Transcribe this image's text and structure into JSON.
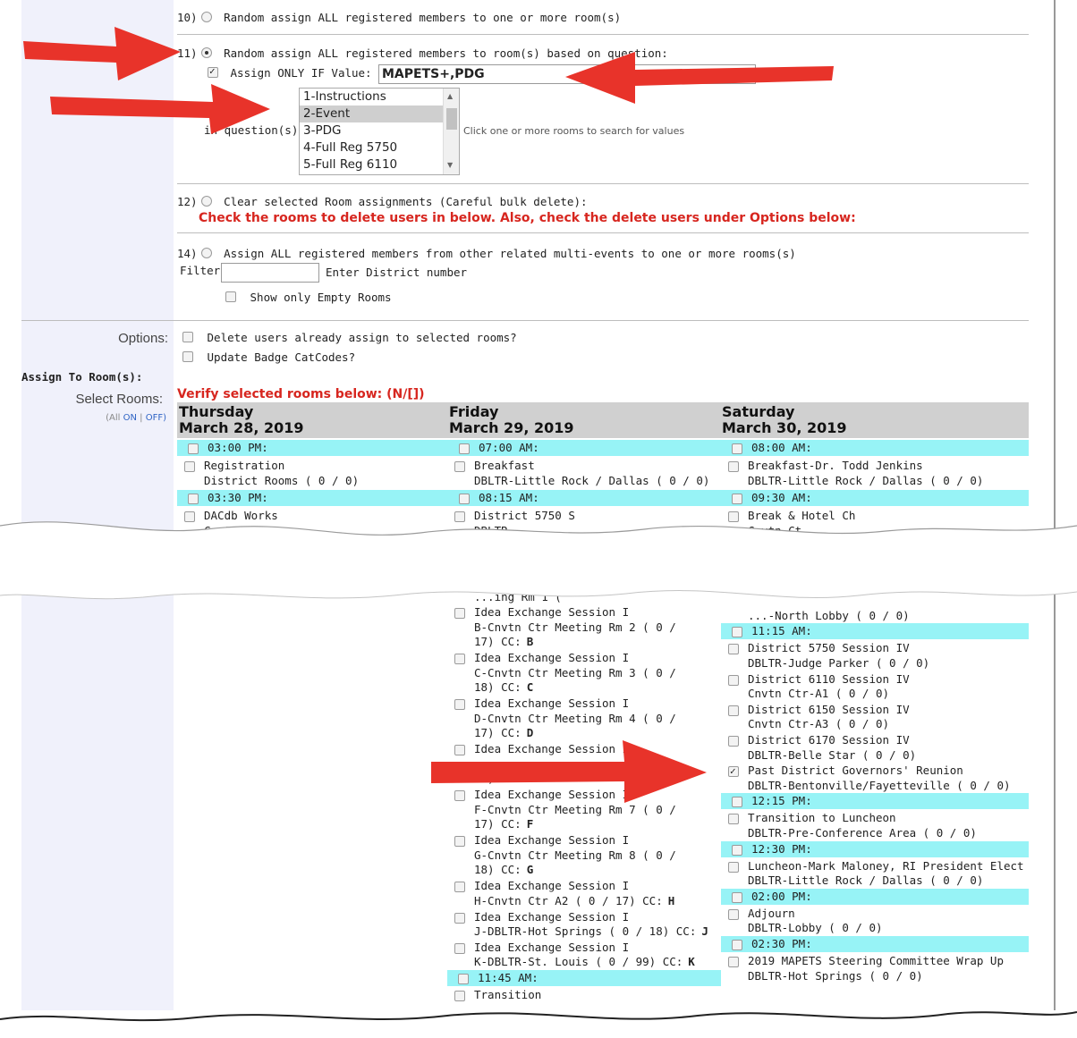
{
  "assign_options": {
    "opt10": {
      "num": "10)",
      "label": "Random assign ALL registered members to one or more room(s)"
    },
    "opt11": {
      "num": "11)",
      "label": "Random assign ALL registered members to room(s) based on question:",
      "assign_only_if_label": "Assign ONLY IF Value:",
      "assign_only_if_value": "MAPETS+,PDG",
      "question_label": "in question(s):",
      "question_options": [
        "1-Instructions",
        "2-Event",
        "3-PDG",
        "4-Full Reg 5750",
        "5-Full Reg 6110"
      ],
      "hint": "Click one or more rooms to search for values"
    },
    "opt12": {
      "num": "12)",
      "label": "Clear selected Room assignments (Careful bulk delete):",
      "warning": "Check the rooms to delete users in below. Also, check the delete users under Options below:"
    },
    "opt14": {
      "num": "14)",
      "label": "Assign ALL registered members from other related multi-events to one or more rooms(s)",
      "filter_label": "Filter:",
      "filter_value": "",
      "filter_hint": "Enter District number",
      "empty_rooms_label": "Show only Empty Rooms"
    }
  },
  "options": {
    "label": "Options:",
    "delete_users": "Delete users already assign to selected rooms?",
    "update_badge": "Update Badge CatCodes?"
  },
  "assign_to_room": {
    "heading": "Assign To Room(s):",
    "select_label": "Select Rooms:",
    "all_prefix": "(All",
    "on": "ON",
    "sep": "|",
    "off": "OFF)",
    "verify": "Verify selected rooms below: (N/[])"
  },
  "days": [
    {
      "name": "Thursday",
      "date": "March 28, 2019"
    },
    {
      "name": "Friday",
      "date": "March 29, 2019"
    },
    {
      "name": "Saturday",
      "date": "March 30, 2019"
    }
  ],
  "top_grid": {
    "thu": [
      {
        "time": "03:00 PM:"
      },
      {
        "title": "Registration",
        "room": "District Rooms ( 0 / 0)"
      },
      {
        "time": "03:30 PM:"
      },
      {
        "title": "DACdb Works",
        "room": "Cnvtn C"
      }
    ],
    "fri": [
      {
        "time": "07:00 AM:"
      },
      {
        "title": "Breakfast",
        "room": "DBLTR-Little Rock / Dallas ( 0 / 0)"
      },
      {
        "time": "08:15 AM:"
      },
      {
        "title": "District 5750 S",
        "room": "DBLTR-"
      }
    ],
    "sat": [
      {
        "time": "08:00 AM:"
      },
      {
        "title": "Breakfast-Dr. Todd Jenkins",
        "room": "DBLTR-Little Rock / Dallas ( 0 / 0)"
      },
      {
        "time": "09:30 AM:"
      },
      {
        "title": "Break & Hotel Ch",
        "room": "Cnvtn Ct"
      }
    ]
  },
  "bottom_fri": [
    {
      "lines": [
        "...ing Rm 1 ("
      ]
    },
    {
      "lines": [
        "Idea Exchange Session I",
        "B-Cnvtn Ctr Meeting Rm 2 ( 0 /",
        "17) CC:"
      ],
      "cc": "B"
    },
    {
      "lines": [
        "Idea Exchange Session I",
        "C-Cnvtn Ctr Meeting Rm 3 ( 0 /",
        "18) CC:"
      ],
      "cc": "C"
    },
    {
      "lines": [
        "Idea Exchange Session I",
        "D-Cnvtn Ctr Meeting Rm 4 ( 0 /",
        "17) CC:"
      ],
      "cc": "D"
    },
    {
      "lines": [
        "Idea Exchange Session I",
        "",
        "18) CC:"
      ],
      "cc": "E"
    },
    {
      "lines": [
        "Idea Exchange Session I",
        "F-Cnvtn Ctr Meeting Rm 7 ( 0 /",
        "17) CC:"
      ],
      "cc": "F"
    },
    {
      "lines": [
        "Idea Exchange Session I",
        "G-Cnvtn Ctr Meeting Rm 8 ( 0 /",
        "18) CC:"
      ],
      "cc": "G"
    },
    {
      "lines": [
        "Idea Exchange Session I",
        "H-Cnvtn Ctr A2 ( 0 / 17) CC:"
      ],
      "cc": "H"
    },
    {
      "lines": [
        "Idea Exchange Session I",
        "J-DBLTR-Hot Springs ( 0 / 18) CC:"
      ],
      "cc": "J"
    },
    {
      "lines": [
        "Idea Exchange Session I",
        "K-DBLTR-St. Louis ( 0 / 99) CC:"
      ],
      "cc": "K"
    },
    {
      "time": "11:45 AM:"
    },
    {
      "lines": [
        "Transition"
      ]
    }
  ],
  "bottom_sat": [
    {
      "lines": [
        "...-North Lobby ( 0 / 0)"
      ]
    },
    {
      "time": "11:15 AM:"
    },
    {
      "lines": [
        "District 5750 Session IV",
        "DBLTR-Judge Parker ( 0 / 0)"
      ]
    },
    {
      "lines": [
        "District 6110 Session IV",
        "Cnvtn Ctr-A1 ( 0 / 0)"
      ]
    },
    {
      "lines": [
        "District 6150 Session IV",
        "Cnvtn Ctr-A3 ( 0 / 0)"
      ]
    },
    {
      "lines": [
        "District 6170 Session IV",
        "DBLTR-Belle Star ( 0 / 0)"
      ]
    },
    {
      "lines": [
        "Past District Governors' Reunion",
        "DBLTR-Bentonville/Fayetteville ( 0 / 0)"
      ],
      "checked": true
    },
    {
      "time": "12:15 PM:"
    },
    {
      "lines": [
        "Transition to Luncheon",
        "DBLTR-Pre-Conference Area ( 0 / 0)"
      ]
    },
    {
      "time": "12:30 PM:"
    },
    {
      "lines": [
        "Luncheon-Mark Maloney, RI President Elect",
        "DBLTR-Little Rock / Dallas ( 0 / 0)"
      ]
    },
    {
      "time": "02:00 PM:"
    },
    {
      "lines": [
        "Adjourn",
        "DBLTR-Lobby ( 0 / 0)"
      ]
    },
    {
      "time": "02:30 PM:"
    },
    {
      "lines": [
        "2019 MAPETS Steering Committee Wrap Up",
        "DBLTR-Hot Springs ( 0 / 0)"
      ]
    }
  ],
  "colors": {
    "time_bar": "#97f3f6",
    "warning": "#d7261f",
    "arrow": "#e8332a",
    "date_header": "#d0d0d0"
  }
}
